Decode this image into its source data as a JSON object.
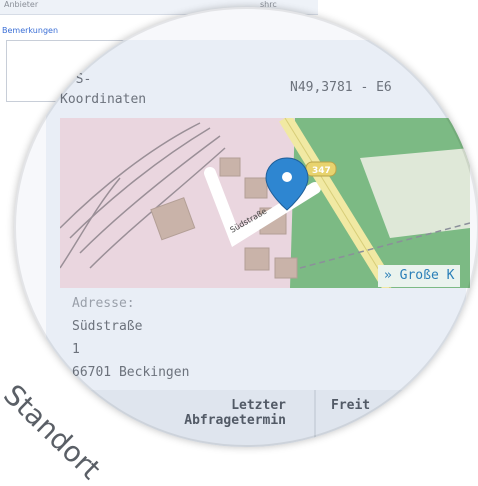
{
  "background": {
    "field_label": "Anbieter",
    "field_value": "shrc",
    "remarks_label": "Bemerkungen"
  },
  "details": {
    "gps_label": "GPS-\nKoordinaten",
    "gps_value": "N49,3781 - E6",
    "map": {
      "street_label": "Südstraße",
      "road_badge": "347",
      "large_map_link": "» Große K"
    },
    "address_label": "Adresse:",
    "address_lines": [
      "Südstraße",
      "1",
      "66701 Beckingen"
    ]
  },
  "table": {
    "col1_header": "Letzter\nAbfragetermin",
    "col2_header": "Freit"
  },
  "caption": "Standort",
  "colors": {
    "map_pink": "#ead6df",
    "map_green": "#78b37d",
    "road_yellow": "#efe79e",
    "marker_blue": "#2e86d1",
    "link_blue": "#2a7fb8"
  }
}
